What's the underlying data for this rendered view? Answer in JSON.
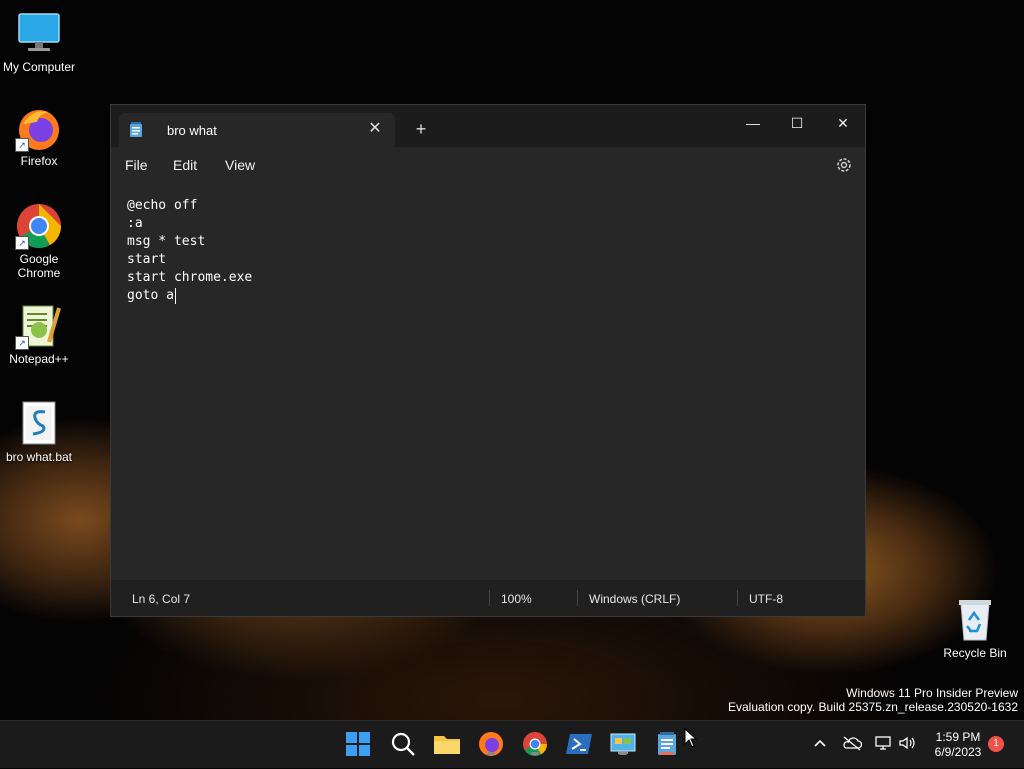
{
  "desktop": {
    "icons": [
      {
        "label": "My Computer",
        "icon": "monitor-icon"
      },
      {
        "label": "Firefox",
        "icon": "firefox-icon"
      },
      {
        "label": "Google\nChrome",
        "icon": "chrome-icon"
      },
      {
        "label": "Notepad++",
        "icon": "notepadpp-icon"
      },
      {
        "label": "bro what.bat",
        "icon": "batch-file-icon"
      },
      {
        "label": "Recycle Bin",
        "icon": "recycle-bin-icon"
      }
    ]
  },
  "window": {
    "tab_title": "bro what",
    "menu": {
      "file": "File",
      "edit": "Edit",
      "view": "View"
    },
    "lines": [
      "@echo off",
      ":a",
      "msg * test",
      "start",
      "start chrome.exe",
      "goto a"
    ],
    "status": {
      "position": "Ln 6, Col 7",
      "zoom": "100%",
      "line_ending": "Windows (CRLF)",
      "encoding": "UTF-8"
    }
  },
  "watermark": {
    "line1": "Windows 11 Pro Insider Preview",
    "line2": "Evaluation copy. Build 25375.zn_release.230520-1632"
  },
  "taskbar": {
    "time": "1:59 PM",
    "date": "6/9/2023",
    "notification_count": "1"
  },
  "colors": {
    "taskbar": "#1b1b1b",
    "window": "#202020",
    "editor": "#272727",
    "accent_indicator": "#f06a5a"
  }
}
